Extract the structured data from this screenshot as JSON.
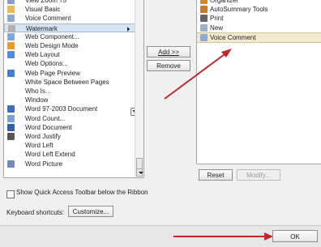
{
  "left_list": {
    "items": [
      {
        "label": "View Zoom 75",
        "icon": "zoom-icon",
        "color": "#7f9fd0"
      },
      {
        "label": "Visual Basic",
        "icon": "visual-basic-icon",
        "color": "#f2b84b"
      },
      {
        "label": "Voice Comment",
        "icon": "voice-comment-icon",
        "color": "#8aa9d6"
      },
      {
        "label": "Watermark",
        "icon": "watermark-icon",
        "color": "#b0b0b0",
        "selected": true,
        "submenu": true
      },
      {
        "label": "Web Component...",
        "icon": "web-component-icon",
        "color": "#7fa7e6"
      },
      {
        "label": "Web Design Mode",
        "icon": "web-design-mode-icon",
        "color": "#f29a1e"
      },
      {
        "label": "Web Layout",
        "icon": "web-layout-icon",
        "color": "#4a90e2"
      },
      {
        "label": "Web Options...",
        "icon": "",
        "color": ""
      },
      {
        "label": "Web Page Preview",
        "icon": "web-page-preview-icon",
        "color": "#3d7fd9"
      },
      {
        "label": "White Space Between Pages",
        "icon": "",
        "color": ""
      },
      {
        "label": "Who Is...",
        "icon": "",
        "color": ""
      },
      {
        "label": "Window",
        "icon": "",
        "color": ""
      },
      {
        "label": "Word 97-2003 Document",
        "icon": "word-97-2003-document-icon",
        "color": "#3a6fc4"
      },
      {
        "label": "Word Count...",
        "icon": "word-count-icon",
        "color": "#7aa0d8"
      },
      {
        "label": "Word Document",
        "icon": "word-document-icon",
        "color": "#2f5fb3"
      },
      {
        "label": "Word Justify",
        "icon": "word-justify-icon",
        "color": "#555555"
      },
      {
        "label": "Word Left",
        "icon": "",
        "color": ""
      },
      {
        "label": "Word Left Extend",
        "icon": "",
        "color": ""
      },
      {
        "label": "Word Picture",
        "icon": "word-picture-icon",
        "color": "#6a8fbf"
      }
    ]
  },
  "right_list": {
    "items": [
      {
        "label": "Organizer",
        "icon": "organizer-icon",
        "color": "#d08a2c"
      },
      {
        "label": "AutoSummary Tools",
        "icon": "autosummary-tools-icon",
        "color": "#c77b2a"
      },
      {
        "label": "Print",
        "icon": "print-icon",
        "color": "#666666"
      },
      {
        "label": "New",
        "icon": "new-document-icon",
        "color": "#9ab0cc"
      },
      {
        "label": "Voice Comment",
        "icon": "voice-comment-icon",
        "color": "#8aa9d6",
        "selected": true
      }
    ]
  },
  "buttons": {
    "add": "Add >>",
    "remove": "Remove",
    "reset": "Reset",
    "modify": "Modify...",
    "customize": "Customize...",
    "ok": "OK"
  },
  "options": {
    "show_below_ribbon": "Show Quick Access Toolbar below the Ribbon",
    "keyboard_shortcuts": "Keyboard shortcuts:"
  },
  "colors": {
    "arrow": "#c0282a",
    "selection_left": "#d7e4f6",
    "selection_right": "#f1ead0"
  }
}
